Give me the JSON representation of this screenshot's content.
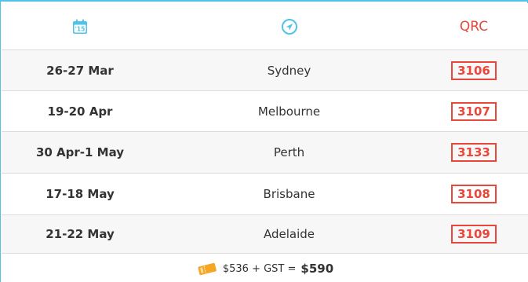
{
  "header": {
    "calendar_icon_text": "'15",
    "location_icon": "location-arrow-icon",
    "qrc_label": "QRC"
  },
  "rows": [
    {
      "date": "26-27 Mar",
      "city": "Sydney",
      "qrc": "3106"
    },
    {
      "date": "19-20 Apr",
      "city": "Melbourne",
      "qrc": "3107"
    },
    {
      "date": "30 Apr-1 May",
      "city": "Perth",
      "qrc": "3133"
    },
    {
      "date": "17-18 May",
      "city": "Brisbane",
      "qrc": "3108"
    },
    {
      "date": "21-22 May",
      "city": "Adelaide",
      "qrc": "3109"
    }
  ],
  "footer": {
    "ticket_icon": "ticket-icon",
    "price_base": "$536 + GST = ",
    "price_total": "$590"
  },
  "colors": {
    "accent_blue": "#4fc3e8",
    "qrc_red": "#e8473a",
    "ticket_orange": "#f5a623"
  }
}
